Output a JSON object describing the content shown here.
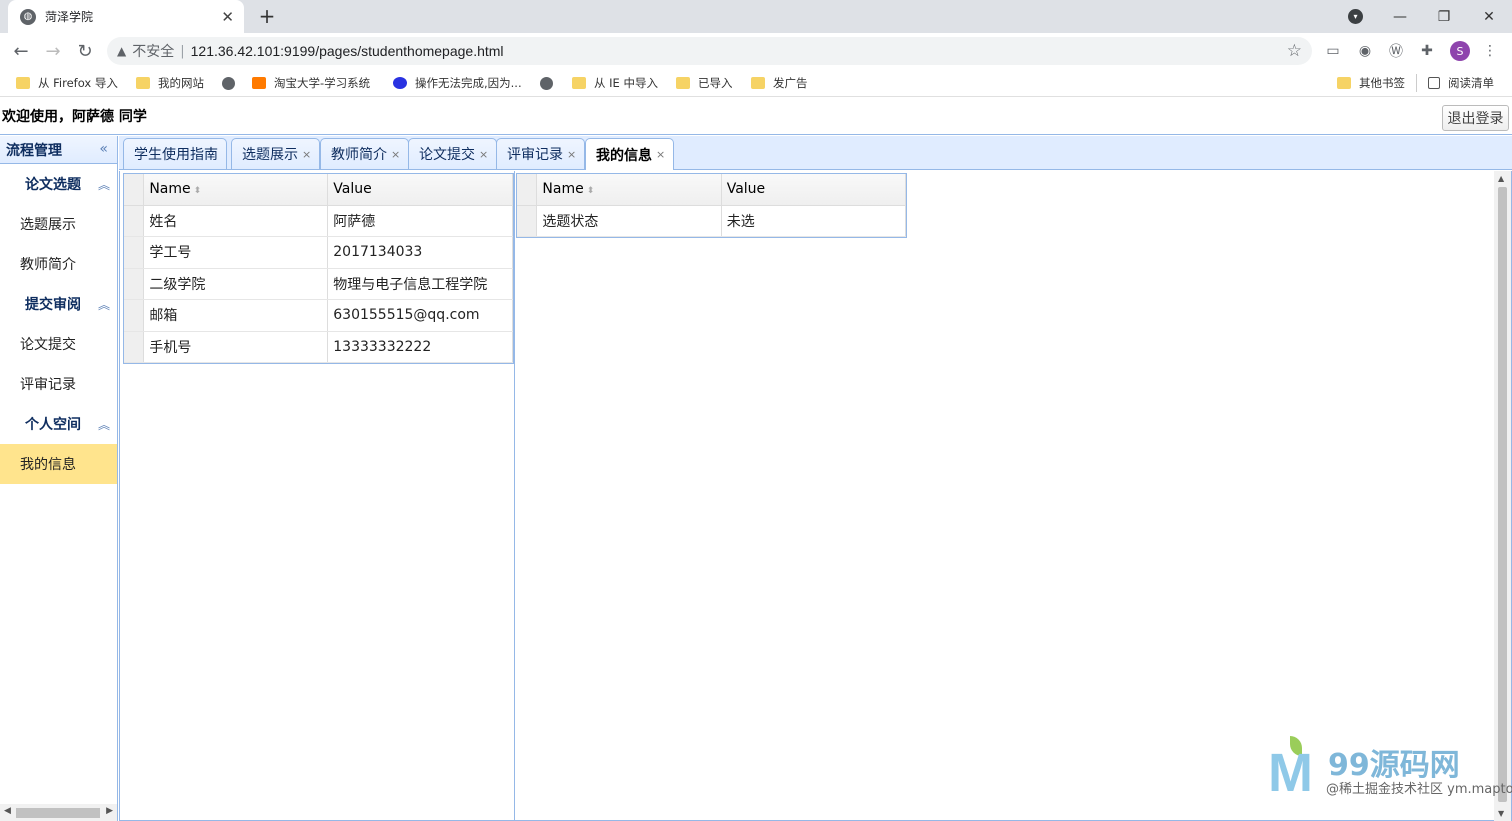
{
  "browser": {
    "tab_title": "菏泽学院",
    "tab_close": "✕",
    "new_tab": "+",
    "insecure_label": "不安全",
    "url": "121.36.42.101:9199/pages/studenthomepage.html",
    "profile_initial": "S",
    "bookmarks": [
      {
        "label": "从 Firefox 导入",
        "icon": "folder-icon"
      },
      {
        "label": "我的网站",
        "icon": "folder-icon"
      },
      {
        "label": "",
        "icon": "globe-icon"
      },
      {
        "label": "淘宝大学-学习系统",
        "icon": "taobao-icon"
      },
      {
        "label": "操作无法完成,因为...",
        "icon": "baidu-icon"
      },
      {
        "label": "",
        "icon": "globe-icon"
      },
      {
        "label": "从 IE 中导入",
        "icon": "folder-icon"
      },
      {
        "label": "已导入",
        "icon": "folder-icon"
      },
      {
        "label": "发广告",
        "icon": "folder-icon"
      },
      {
        "label": "其他书签",
        "icon": "folder-icon"
      },
      {
        "label": "阅读清单",
        "icon": "reading-list-icon"
      }
    ]
  },
  "header": {
    "welcome": "欢迎使用，阿萨德 同学",
    "logout_label": "退出登录"
  },
  "sidebar": {
    "title": "流程管理",
    "groups": [
      {
        "label": "论文选题",
        "items": [
          "选题展示",
          "教师简介"
        ]
      },
      {
        "label": "提交审阅",
        "items": [
          "论文提交",
          "评审记录"
        ]
      },
      {
        "label": "个人空间",
        "items": [
          "我的信息"
        ]
      }
    ],
    "selected": "我的信息"
  },
  "tabs": [
    {
      "label": "学生使用指南",
      "closable": false
    },
    {
      "label": "选题展示",
      "closable": true
    },
    {
      "label": "教师简介",
      "closable": true
    },
    {
      "label": "论文提交",
      "closable": true
    },
    {
      "label": "评审记录",
      "closable": true
    },
    {
      "label": "我的信息",
      "closable": true,
      "active": true
    }
  ],
  "tab_close_glyph": "×",
  "info_grid": {
    "columns": [
      "Name",
      "Value"
    ],
    "rows": [
      [
        "姓名",
        "阿萨德"
      ],
      [
        "学工号",
        "2017134033"
      ],
      [
        "二级学院",
        "物理与电子信息工程学院"
      ],
      [
        "邮箱",
        "630155515@qq.com"
      ],
      [
        "手机号",
        "13333332222"
      ]
    ]
  },
  "status_grid": {
    "columns": [
      "Name",
      "Value"
    ],
    "rows": [
      [
        "选题状态",
        "未选"
      ]
    ]
  },
  "watermark": {
    "brand": "99源码网",
    "sub": "@稀土掘金技术社区 ym.maptoface.com"
  },
  "colors": {
    "border": "#95b8e7",
    "header_bg": "#e0ecff",
    "selected_item": "#ffe48d"
  }
}
